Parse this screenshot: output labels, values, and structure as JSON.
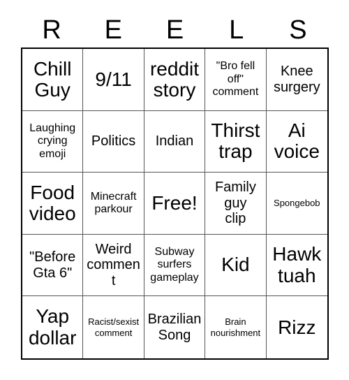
{
  "card": {
    "title_letters": [
      "R",
      "E",
      "E",
      "L",
      "S"
    ],
    "columns": 5,
    "rows": 5,
    "border_color": "#000000",
    "grid_line_color": "#555555",
    "background_color": "#ffffff",
    "text_color": "#000000",
    "free_space": "Free!"
  },
  "squares": [
    {
      "text": "Chill\nGuy",
      "size": "xl"
    },
    {
      "text": "9/11",
      "size": "xl"
    },
    {
      "text": "reddit\nstory",
      "size": "xl"
    },
    {
      "text": "\"Bro fell\noff\"\ncomment",
      "size": "sm"
    },
    {
      "text": "Knee\nsurgery",
      "size": "md"
    },
    {
      "text": "Laughing\ncrying\nemoji",
      "size": "sm"
    },
    {
      "text": "Politics",
      "size": "md"
    },
    {
      "text": "Indian",
      "size": "md"
    },
    {
      "text": "Thirst\ntrap",
      "size": "xl"
    },
    {
      "text": "Ai\nvoice",
      "size": "xl"
    },
    {
      "text": "Food\nvideo",
      "size": "xl"
    },
    {
      "text": "Minecraft\nparkour",
      "size": "sm"
    },
    {
      "text": "Free!",
      "size": "xl"
    },
    {
      "text": "Family\nguy\nclip",
      "size": "md"
    },
    {
      "text": "Spongebob",
      "size": "xs"
    },
    {
      "text": "\"Before\nGta 6\"",
      "size": "md"
    },
    {
      "text": "Weird\ncomment",
      "size": "md"
    },
    {
      "text": "Subway\nsurfers\ngameplay",
      "size": "sm"
    },
    {
      "text": "Kid",
      "size": "xl"
    },
    {
      "text": "Hawk\ntuah",
      "size": "xl"
    },
    {
      "text": "Yap\ndollar",
      "size": "xl"
    },
    {
      "text": "Racist/sexist\ncomment",
      "size": "xs"
    },
    {
      "text": "Brazilian\nSong",
      "size": "md"
    },
    {
      "text": "Brain\nnourishment",
      "size": "xs"
    },
    {
      "text": "Rizz",
      "size": "xl"
    }
  ]
}
